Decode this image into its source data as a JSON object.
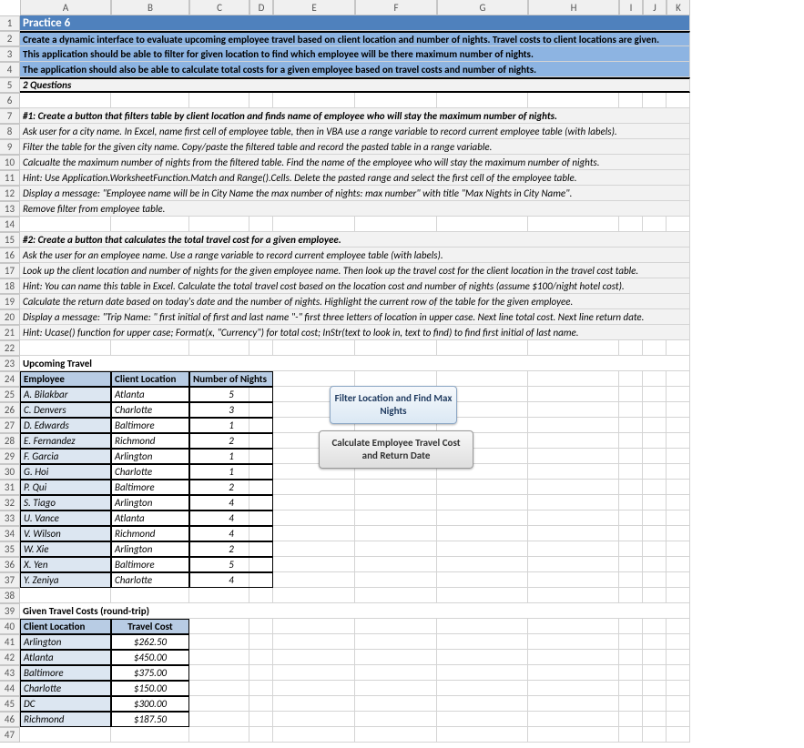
{
  "cols": [
    "A",
    "B",
    "C",
    "D",
    "E",
    "F",
    "G",
    "H",
    "I",
    "J",
    "K"
  ],
  "rows": 47,
  "r1": "Practice 6",
  "r2": "Create a dynamic interface to evaluate upcoming employee travel based on client location and number of nights. Travel costs to client locations are given.",
  "r3": "This application should be able to filter for given location to find which employee will be there maximum number of nights.",
  "r4": "The application should also be able to calculate total costs for a given employee based on travel costs and number of nights.",
  "r5": "2 Questions",
  "r7": "#1: Create a button that filters table by client location and finds name of employee who will stay the maximum number of nights.",
  "r8": "Ask user for a city name. In Excel, name first cell of employee table, then in VBA use a range variable to record current employee table (with labels).",
  "r9": "Filter the table for the given city name. Copy/paste the filtered table and record the pasted table in a range variable.",
  "r10": "Calcualte the maximum number of nights from the filtered table. Find the name of the employee who will stay the maximum number of nights.",
  "r11": "Hint: Use Application.WorksheetFunction.Match and  Range().Cells. Delete the pasted range and select the first cell of the employee table.",
  "r12": "Display a message: \"Employee name will be in City Name the max number of nights: max number\" with title \"Max Nights in City Name\".",
  "r13": "Remove filter from employee table.",
  "r15": "#2: Create a button that calculates the total travel cost for a given employee.",
  "r16": "Ask the user for an employee name. Use a range variable to record current employee table (with labels).",
  "r17": "Look up the client location and number of nights for the given employee name. Then look up the travel cost for the client location in the travel cost table.",
  "r18": "Hint: You can name this table in Excel. Calculate the total travel cost based on the location cost and number of nights (assume $100/night hotel cost).",
  "r19": "Calculate the return date based on today's date and the number of nights. Highlight the current row of the table for the given employee.",
  "r20": "Display a message: \"Trip Name: \" first initial of first and last name \"-\" first three letters of location in upper case. Next line total cost. Next line return date.",
  "r21": "Hint: Ucase() function for upper case; Format(x, \"Currency\") for total cost; InStr(text to look in, text to find) to find first initial of last name.",
  "r23": "Upcoming Travel",
  "t1": {
    "h": [
      "Employee",
      "Client Location",
      "Number of Nights"
    ],
    "rows": [
      [
        "A. Bilakbar",
        "Atlanta",
        "5"
      ],
      [
        "C. Denvers",
        "Charlotte",
        "3"
      ],
      [
        "D. Edwards",
        "Baltimore",
        "1"
      ],
      [
        "E. Fernandez",
        "Richmond",
        "2"
      ],
      [
        "F. Garcia",
        "Arlington",
        "1"
      ],
      [
        "G. Hoi",
        "Charlotte",
        "1"
      ],
      [
        "P. Qui",
        "Baltimore",
        "2"
      ],
      [
        "S. Tiago",
        "Arlington",
        "4"
      ],
      [
        "U. Vance",
        "Atlanta",
        "4"
      ],
      [
        "V. Wilson",
        "Richmond",
        "4"
      ],
      [
        "W. Xie",
        "Arlington",
        "2"
      ],
      [
        "X. Yen",
        "Baltimore",
        "5"
      ],
      [
        "Y. Zeniya",
        "Charlotte",
        "4"
      ]
    ]
  },
  "r39": "Given Travel Costs (round-trip)",
  "t2": {
    "h": [
      "Client Location",
      "Travel Cost"
    ],
    "rows": [
      [
        "Arlington",
        "$262.50"
      ],
      [
        "Atlanta",
        "$450.00"
      ],
      [
        "Baltimore",
        "$375.00"
      ],
      [
        "Charlotte",
        "$150.00"
      ],
      [
        "DC",
        "$300.00"
      ],
      [
        "Richmond",
        "$187.50"
      ]
    ]
  },
  "btn1": "Filter Location and Find Max Nights",
  "btn2": "Calculate Employee Travel Cost and Return Date"
}
